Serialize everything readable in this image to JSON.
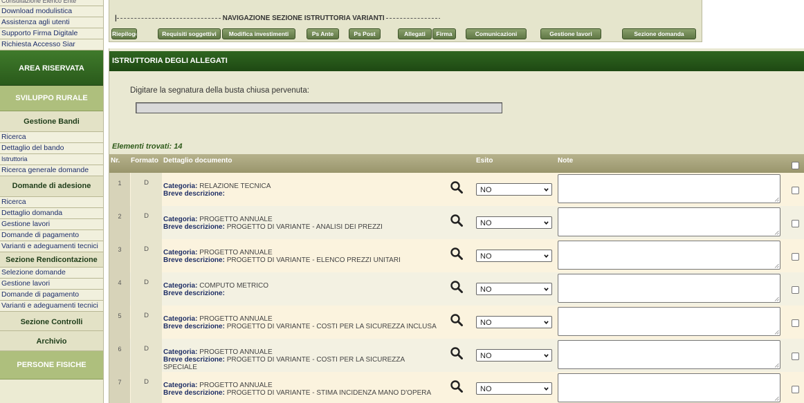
{
  "sidebar": {
    "cut_top": "Consultazione Elenco Ente",
    "items_top": [
      "Download modulistica",
      "Assistenza agli utenti",
      "Supporto Firma Digitale",
      "Richiesta Accesso Siar"
    ],
    "area_riservata": "AREA RISERVATA",
    "sviluppo_rurale": "SVILUPPO RURALE",
    "gestione_bandi": "Gestione Bandi",
    "bandi_items": [
      "Ricerca",
      "Dettaglio del bando",
      "Istruttoria",
      "Ricerca generale domande"
    ],
    "domande_adesione": "Domande di adesione",
    "adesione_items": [
      "Ricerca",
      "Dettaglio domanda",
      "Gestione lavori",
      "Domande di pagamento",
      "Varianti e adeguamenti tecnici"
    ],
    "sezione_rendicontazione": "Sezione Rendicontazione",
    "rendicontazione_items": [
      "Selezione domande",
      "Gestione lavori",
      "Domande di pagamento",
      "Varianti e adeguamenti tecnici"
    ],
    "sezione_controlli": "Sezione Controlli",
    "archivio": "Archivio",
    "persone_fisiche": "PERSONE FISICHE"
  },
  "nav": {
    "title": "NAVIGAZIONE SEZIONE ISTRUTTORIA VARIANTI",
    "bar_start": "|",
    "bar_end": "|",
    "buttons": [
      "Riepilogo",
      "Requisiti soggettivi",
      "Modifica investimenti",
      "Ps Ante",
      "Ps Post",
      "Allegati",
      "Firma",
      "Comunicazioni",
      "Gestione lavori",
      "Sezione domanda"
    ]
  },
  "main": {
    "header": "ISTRUTTORIA DEGLI ALLEGATI",
    "signature_label": "Digitare la segnatura della busta chiusa pervenuta:",
    "signature_value": "",
    "found_label": "Elementi trovati: 14"
  },
  "table": {
    "headers": {
      "nr": "Nr.",
      "formato": "Formato",
      "dettaglio": "Dettaglio documento",
      "esito": "Esito",
      "note": "Note"
    },
    "category_label": "Categoria:",
    "description_label": "Breve descrizione:",
    "rows": [
      {
        "nr": "1",
        "formato": "D",
        "categoria": "RELAZIONE TECNICA",
        "descrizione": "",
        "esito": "NO"
      },
      {
        "nr": "2",
        "formato": "D",
        "categoria": "PROGETTO ANNUALE",
        "descrizione": "PROGETTO DI VARIANTE - ANALISI DEI PREZZI",
        "esito": "NO"
      },
      {
        "nr": "3",
        "formato": "D",
        "categoria": "PROGETTO ANNUALE",
        "descrizione": "PROGETTO DI VARIANTE - ELENCO PREZZI UNITARI",
        "esito": "NO"
      },
      {
        "nr": "4",
        "formato": "D",
        "categoria": "COMPUTO METRICO",
        "descrizione": "",
        "esito": "NO"
      },
      {
        "nr": "5",
        "formato": "D",
        "categoria": "PROGETTO ANNUALE",
        "descrizione": "PROGETTO DI VARIANTE - COSTI PER LA SICUREZZA INCLUSA",
        "esito": "NO"
      },
      {
        "nr": "6",
        "formato": "D",
        "categoria": "PROGETTO ANNUALE",
        "descrizione": "PROGETTO DI VARIANTE - COSTI PER LA SICUREZZA SPECIALE",
        "esito": "NO"
      },
      {
        "nr": "7",
        "formato": "D",
        "categoria": "PROGETTO ANNUALE",
        "descrizione": "PROGETTO DI VARIANTE - STIMA INCIDENZA MANO D'OPERA",
        "esito": "NO"
      }
    ]
  },
  "icons": {
    "view": "magnifier-icon",
    "select": "chevron-down-icon",
    "resize": "resize-grip-icon"
  },
  "colors": {
    "dark_green": "#2a5a1b",
    "olive": "#aebf7d",
    "beige": "#e9e8d2",
    "link": "#1c2d6b"
  }
}
